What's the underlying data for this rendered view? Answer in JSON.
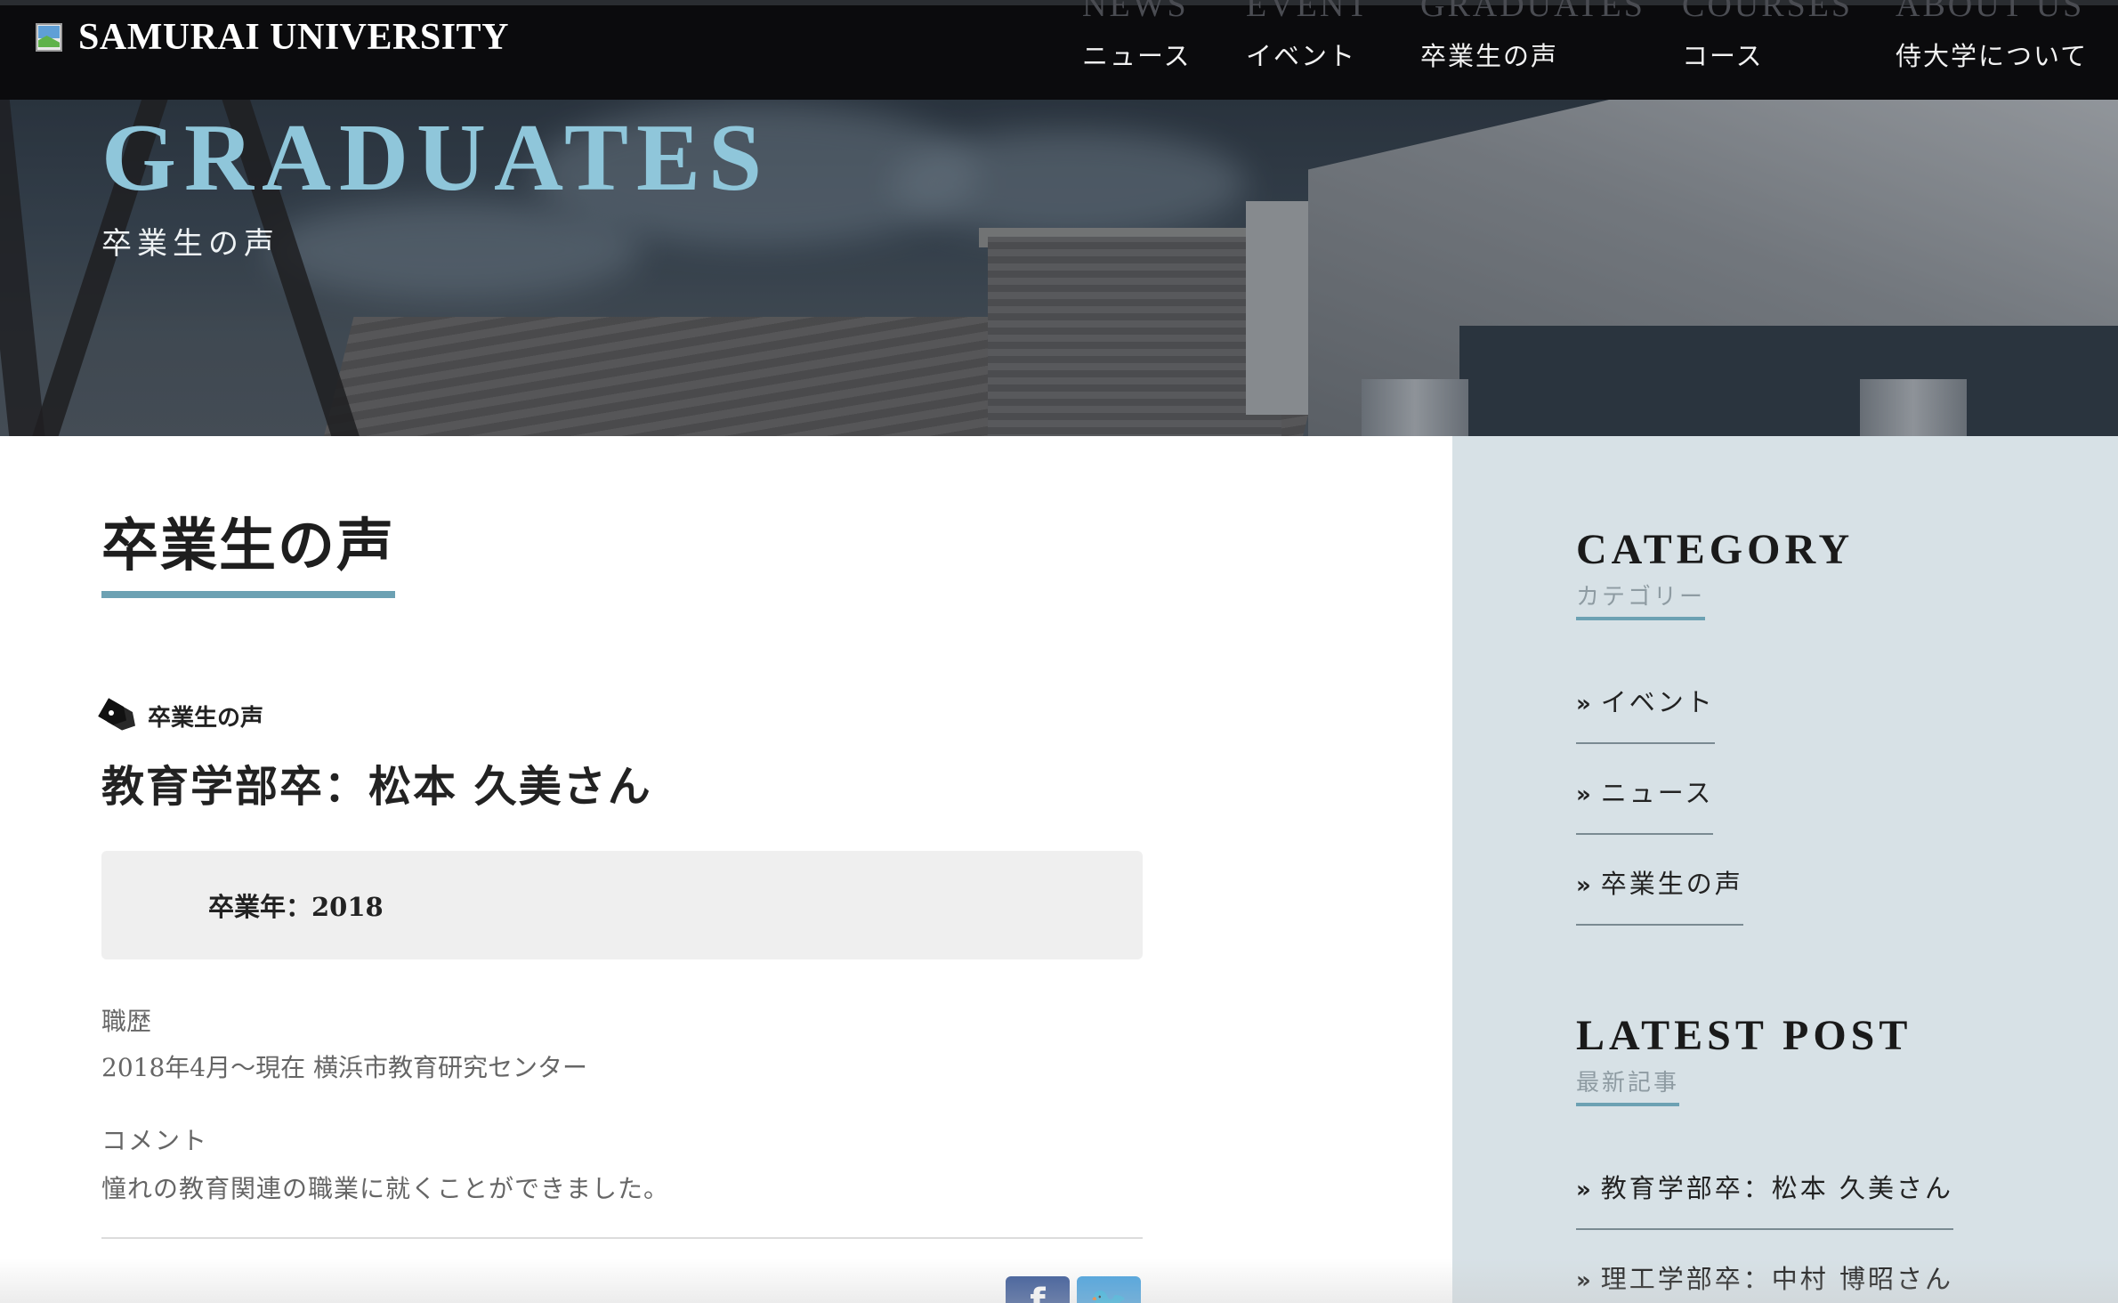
{
  "header": {
    "logo_text": "SAMURAI UNIVERSITY",
    "nav": [
      {
        "en": "NEWS",
        "ja": "ニュース"
      },
      {
        "en": "EVENT",
        "ja": "イベント"
      },
      {
        "en": "GRADUATES",
        "ja": "卒業生の声"
      },
      {
        "en": "COURSES",
        "ja": "コース"
      },
      {
        "en": "ABOUT US",
        "ja": "侍大学について"
      }
    ]
  },
  "hero": {
    "title": "GRADUATES",
    "subtitle": "卒業生の声"
  },
  "main": {
    "heading": "卒業生の声",
    "tag": "卒業生の声",
    "post_title": "教育学部卒：松本 久美さん",
    "graduation_year": "卒業年：2018",
    "career_label": "職歴",
    "career_text": "2018年4月〜現在 横浜市教育研究センター",
    "comment_label": "コメント",
    "comment_text": "憧れの教育関連の職業に就くことができました。",
    "share": {
      "facebook_icon": "f",
      "twitter_icon": "🐦"
    }
  },
  "sidebar": {
    "category_title": "CATEGORY",
    "category_sub": "カテゴリー",
    "categories": [
      "イベント",
      "ニュース",
      "卒業生の声"
    ],
    "latest_title": "LATEST POST",
    "latest_sub": "最新記事",
    "latest_posts": [
      "教育学部卒：松本 久美さん",
      "理工学部卒：中村 博昭さん"
    ],
    "arrow": "»"
  },
  "colors": {
    "accent": "#6ca1b3",
    "hero_title": "#8fc6da",
    "sidebar_bg": "#d7e1e6",
    "facebook": "#3b5998",
    "twitter": "#4aa3df"
  }
}
